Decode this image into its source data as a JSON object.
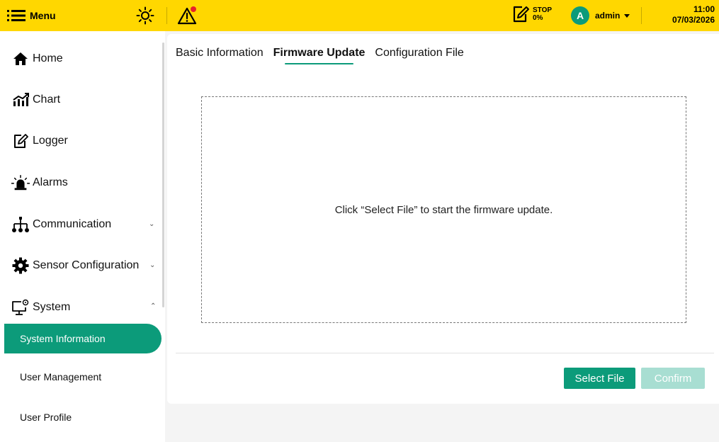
{
  "topbar": {
    "menu_label": "Menu",
    "status": {
      "state": "STOP",
      "percent": "0%"
    },
    "user": {
      "initial": "A",
      "name": "admin"
    },
    "clock": {
      "time": "11:00",
      "date": "07/03/2026"
    }
  },
  "sidebar": {
    "items": [
      {
        "label": "Home",
        "icon": "home-icon"
      },
      {
        "label": "Chart",
        "icon": "chart-icon"
      },
      {
        "label": "Logger",
        "icon": "logger-icon"
      },
      {
        "label": "Alarms",
        "icon": "alarm-icon"
      },
      {
        "label": "Communication",
        "icon": "network-icon",
        "expandable": true
      },
      {
        "label": "Sensor Configuration",
        "icon": "gear-icon",
        "expandable": true
      },
      {
        "label": "System",
        "icon": "monitor-gear-icon",
        "expanded": true
      }
    ],
    "sub_items": [
      {
        "label": "System Information",
        "active": true
      },
      {
        "label": "User Management"
      },
      {
        "label": "User Profile"
      }
    ]
  },
  "tabs": [
    {
      "label": "Basic Information"
    },
    {
      "label": "Firmware Update",
      "active": true
    },
    {
      "label": "Configuration File"
    }
  ],
  "main": {
    "instruction": "Click “Select File” to start the firmware update.",
    "select_button": "Select File",
    "confirm_button": "Confirm"
  },
  "colors": {
    "topbar": "#ffd700",
    "accent": "#0c9b7a",
    "accent_disabled": "#a8ded2",
    "alert_dot": "#e8202a"
  }
}
